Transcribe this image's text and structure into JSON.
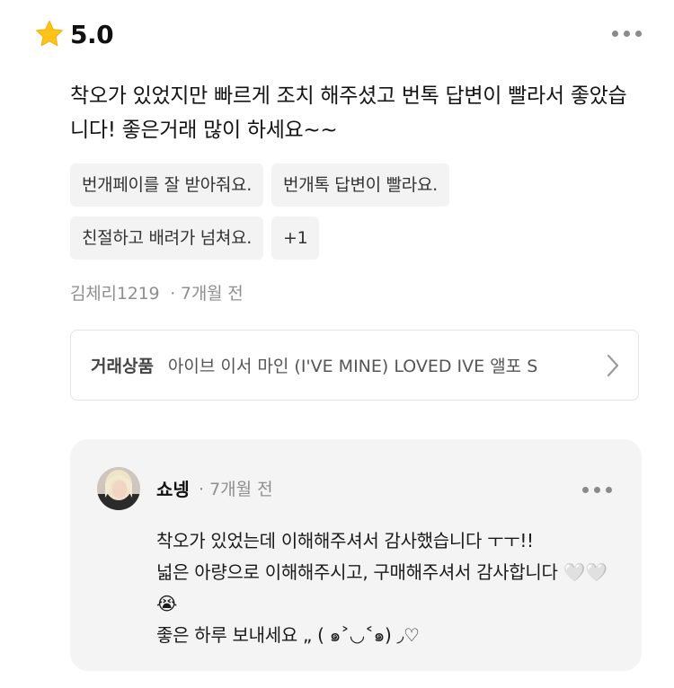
{
  "review": {
    "rating": "5.0",
    "text": "착오가 있었지만 빠르게 조치 해주셨고 번톡 답변이 빨라서 좋았습니다! 좋은거래 많이 하세요~~",
    "tags_row1": [
      "번개페이를 잘 받아줘요.",
      "번개톡 답변이 빨라요."
    ],
    "tags_row2": [
      "친절하고 배려가 넘쳐요.",
      "+1"
    ],
    "author": "김체리1219",
    "time": "· 7개월 전"
  },
  "product": {
    "label": "거래상품",
    "name": "아이브 이서 마인 (I'VE MINE) LOVED IVE 앨포 S"
  },
  "reply": {
    "name": "쇼넹",
    "time": "· 7개월 전",
    "text": "착오가 있었는데 이해해주셔서 감사했습니다 ㅜㅜ!!\n넓은 아량으로 이해해주시고, 구매해주셔서 감사합니다 🤍🤍😭\n좋은 하루 보내세요 „ ( ๑˃◡˂๑) ◞♡"
  },
  "icons": {
    "star": "star-icon",
    "more": "more-horizontal-icon",
    "chevron": "chevron-right-icon"
  },
  "colors": {
    "star": "#FFC21A",
    "tag_bg": "#F3F3F3",
    "reply_bg": "#F4F4F4",
    "muted_text": "#8F8F8F"
  }
}
